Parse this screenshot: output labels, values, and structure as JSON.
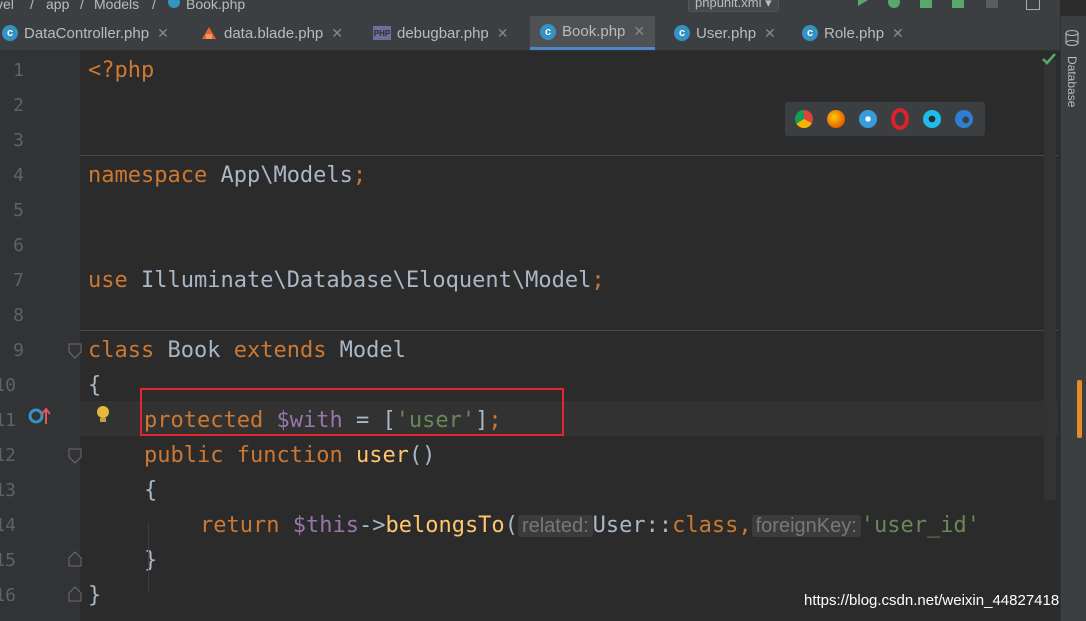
{
  "breadcrumb": [
    "vel",
    "app",
    "Models",
    "Book.php"
  ],
  "run_config": "phpunit.xml",
  "tabs": [
    {
      "label": "DataController.php",
      "icon": "php-class-icon"
    },
    {
      "label": "data.blade.php",
      "icon": "blade-icon"
    },
    {
      "label": "debugbar.php",
      "icon": "php-file-icon"
    },
    {
      "label": "Book.php",
      "icon": "php-class-icon",
      "active": true
    },
    {
      "label": "User.php",
      "icon": "php-class-icon"
    },
    {
      "label": "Role.php",
      "icon": "php-class-icon"
    }
  ],
  "line_numbers": [
    "1",
    "2",
    "3",
    "4",
    "5",
    "6",
    "7",
    "8",
    "9",
    "10",
    "11",
    "12",
    "13",
    "14",
    "15",
    "16"
  ],
  "code": {
    "l1": "<?php",
    "l4_kw": "namespace",
    "l4_ns": " App\\Models",
    "l4_end": ";",
    "l7_kw": "use",
    "l7_ns": " Illuminate\\Database\\Eloquent\\Model",
    "l7_end": ";",
    "l9_kw1": "class",
    "l9_name": " Book ",
    "l9_kw2": "extends",
    "l9_parent": " Model",
    "l10": "{",
    "l11_kw": "protected",
    "l11_var": " $with",
    "l11_eq": " = [",
    "l11_str": "'user'",
    "l11_close": "]",
    "l11_end": ";",
    "l12_kw1": "public",
    "l12_kw2": " function",
    "l12_fn": " user",
    "l12_paren": "()",
    "l13": "{",
    "l14_kw": "return",
    "l14_var": " $this",
    "l14_arrow": "->",
    "l14_fn": "belongsTo",
    "l14_paren": "(",
    "l14_hint1": "related:",
    "l14_cls": "User::",
    "l14_clskw": "class",
    "l14_comma": ",",
    "l14_hint2": "foreignKey:",
    "l14_str": "'user_id'",
    "l15": "}",
    "l16": "}"
  },
  "sidebar_label": "Database",
  "browsers": [
    "chrome-icon",
    "firefox-icon",
    "safari-icon",
    "opera-icon",
    "ie-icon",
    "edge-icon"
  ],
  "watermark": "https://blog.csdn.net/weixin_44827418",
  "colors": {
    "keyword": "#cc7832",
    "variable": "#9876aa",
    "string": "#6a8759",
    "function": "#ffc66d",
    "highlight": "#e3262e"
  }
}
